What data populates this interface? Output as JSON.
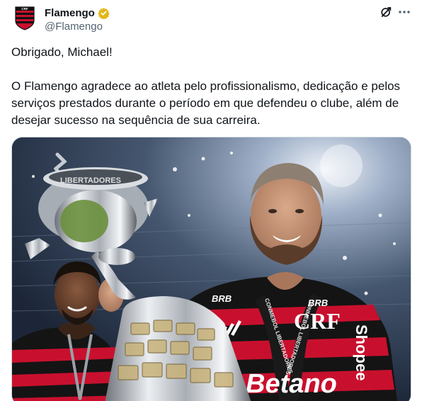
{
  "author": {
    "display_name": "Flamengo",
    "handle": "@Flamengo",
    "verified_badge": "gold-verified-icon",
    "avatar": "flamengo-crest-icon"
  },
  "header_actions": {
    "grok_icon": "grok-icon",
    "more_icon": "more-icon"
  },
  "tweet": {
    "line1": "Obrigado, Michael!",
    "paragraph2": "O Flamengo agradece ao atleta pelo profissionalismo, dedicação e pelos serviços prestados durante o período em que defendeu o clube, além de desejar sucesso na sequência de sua carreira."
  },
  "media": {
    "shirt_sponsor_left": "BRB",
    "shirt_sponsor_right": "BRB",
    "shirt_brand_side": "Shopee",
    "shirt_front": "Betano",
    "medal_ribbon_left": "CONMEBOL LIBERTADORES",
    "medal_ribbon_right": "CONMEBOL LIBERTADORES",
    "trophy_band": "LIBERTADORES"
  },
  "colors": {
    "flamengo_red": "#c8102e",
    "flamengo_black": "#111111",
    "verified_gold": "#e2b719",
    "text_primary": "#0f1419",
    "text_secondary": "#536471"
  }
}
